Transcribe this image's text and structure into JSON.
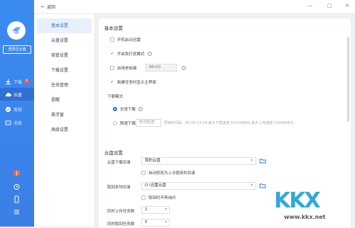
{
  "sidebar": {
    "login_label": "登录迅云盘",
    "items": [
      {
        "label": "下载",
        "badge": "9"
      },
      {
        "label": "云盘"
      },
      {
        "label": "发现"
      },
      {
        "label": "消息"
      }
    ]
  },
  "topbar": {
    "back_label": "返回"
  },
  "menu": {
    "items": [
      "基本设置",
      "云盘设置",
      "接管设置",
      "下载设置",
      "任务管理",
      "提醒",
      "悬浮窗",
      "高级设置"
    ]
  },
  "basic": {
    "title": "基本设置",
    "auto_start": "开机启动迅雷",
    "no_disturb": "开启免打扰模式",
    "boss_key": "启用老板键",
    "boss_key_value": "Alt+D",
    "show_main": "新建任务时显示主界面",
    "download_mode_label": "下载模式",
    "full_speed": "全速下载",
    "limit_speed": "限速下载",
    "modify_config": "修改配置",
    "limit_info": "限速时间段：00:00-23:59  最大下载速度:10240KB/S  最大上传速度:10240KB/S"
  },
  "cloud": {
    "title": "云盘设置",
    "download_dir_label": "云盘下载目录",
    "download_dir_value": "我的云盘",
    "auto_modify": "自动修改为上次使用的目录",
    "local_dir_label": "取回本地目录",
    "local_dir_value": "D:\\迅雷云盘",
    "no_ask": "取回时不再询问",
    "upload_count_label": "同时上传任务数",
    "upload_count_value": "2",
    "fetch_count_label": "同时取回任务数",
    "fetch_count_value": "5"
  },
  "watermark": {
    "logo": "KKX",
    "site": "www.kkx.net"
  }
}
